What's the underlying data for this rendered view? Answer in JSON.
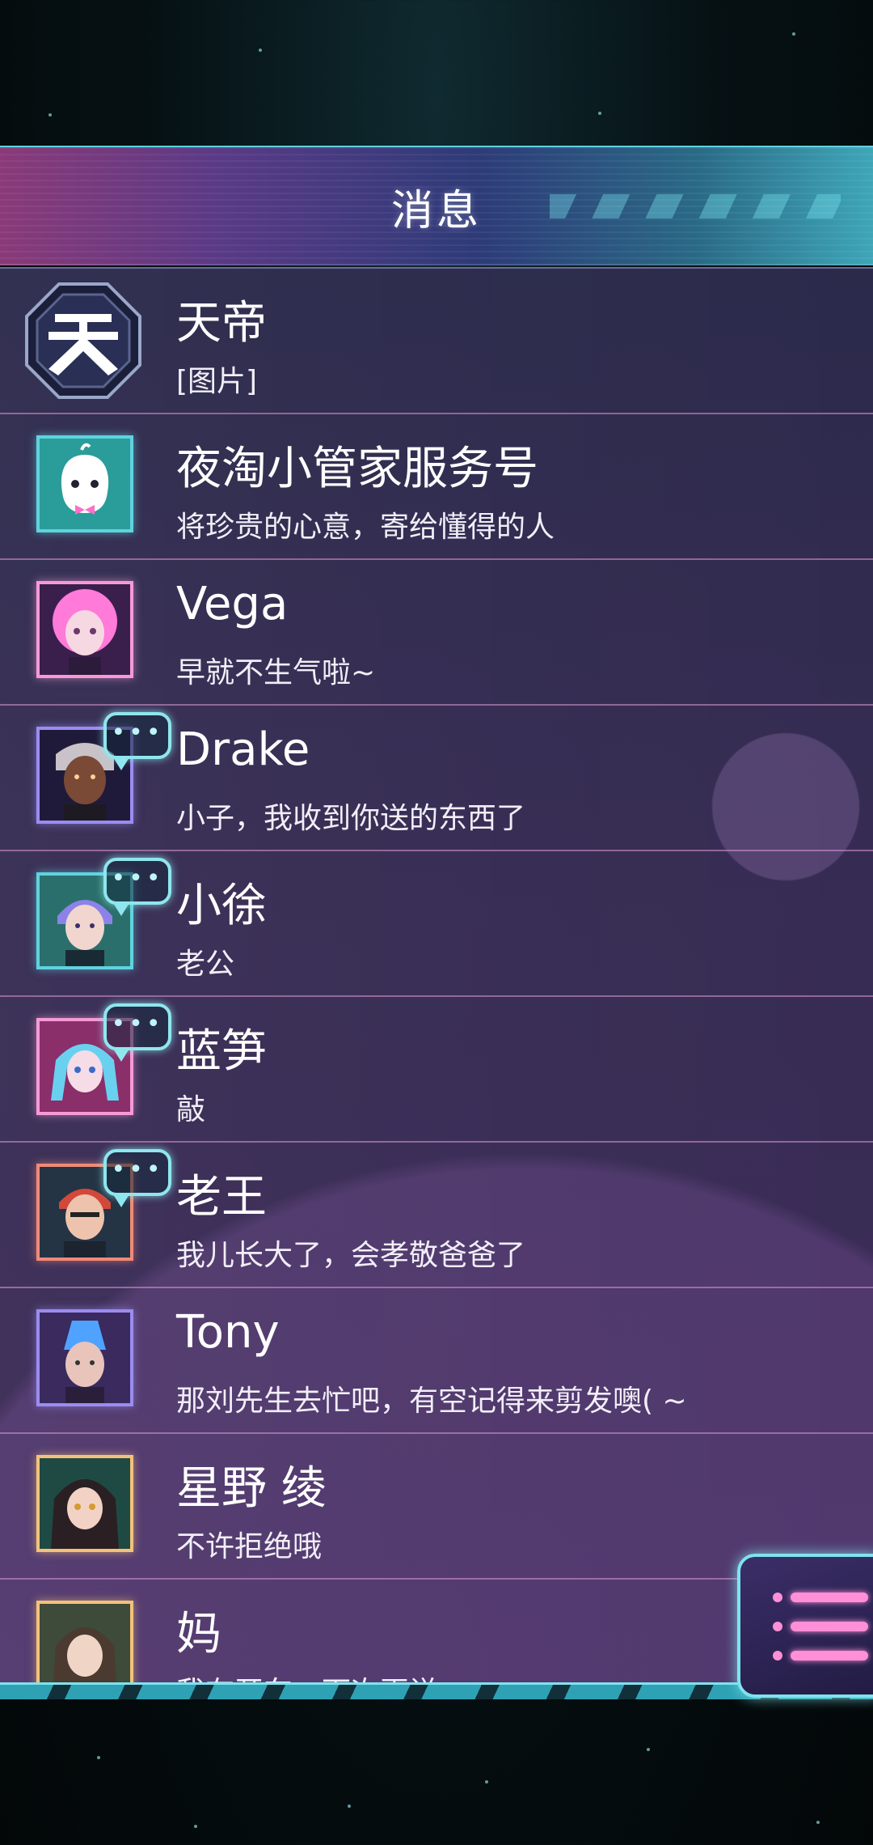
{
  "header": {
    "title": "消息"
  },
  "conversations": [
    {
      "name": "天帝",
      "message": "[图片]",
      "avatar": "tian-emblem",
      "unread": false
    },
    {
      "name": "夜淘小管家服务号",
      "message": "将珍贵的心意，寄给懂得的人",
      "avatar": "ghost-mascot",
      "unread": false
    },
    {
      "name": "Vega",
      "message": "早就不生气啦~",
      "avatar": "pink-hair-girl",
      "unread": false
    },
    {
      "name": "Drake",
      "message": "小子，我收到你送的东西了",
      "avatar": "dark-skin-man",
      "unread": true
    },
    {
      "name": "小徐",
      "message": "老公",
      "avatar": "purple-hair-boy",
      "unread": true
    },
    {
      "name": "蓝笋",
      "message": "敲",
      "avatar": "blue-twin-tails-girl",
      "unread": true
    },
    {
      "name": "老王",
      "message": "我儿长大了，会孝敬爸爸了",
      "avatar": "red-hair-man",
      "unread": true
    },
    {
      "name": "Tony",
      "message": "那刘先生去忙吧，有空记得来剪发噢( ~",
      "avatar": "blue-mohawk-man",
      "unread": false
    },
    {
      "name": "星野 绫",
      "message": "不许拒绝哦",
      "avatar": "dark-hair-girl",
      "unread": false
    },
    {
      "name": "妈",
      "message": "我在开车，下次再说",
      "avatar": "mother",
      "unread": false
    }
  ],
  "menu": {
    "icon": "menu-list-icon"
  },
  "colors": {
    "accent": "#5fd3df",
    "pink": "#ff8fd6",
    "list_bg": "#2b2a4b"
  }
}
